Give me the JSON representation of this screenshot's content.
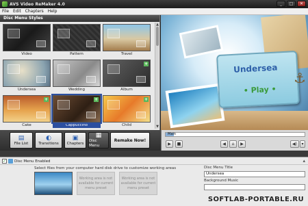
{
  "window": {
    "title": "AVS Video ReMaker 4.0",
    "minimize": "_",
    "maximize": "□",
    "close": "✕"
  },
  "menu": [
    "File",
    "Edit",
    "Chapters",
    "Help"
  ],
  "left_panel": {
    "header": "Disc Menu Styles",
    "styles": [
      {
        "label": "Video",
        "bg": "bg-video"
      },
      {
        "label": "Pattern",
        "bg": "bg-pattern"
      },
      {
        "label": "Travel",
        "bg": "bg-travel"
      },
      {
        "label": "Undersea",
        "bg": "bg-undersea"
      },
      {
        "label": "Wedding",
        "bg": "bg-wedding"
      },
      {
        "label": "Album",
        "bg": "bg-album"
      },
      {
        "label": "Cake",
        "bg": "bg-cake"
      },
      {
        "label": "Cappuccino",
        "bg": "bg-cappuccino"
      },
      {
        "label": "Child",
        "bg": "bg-child"
      }
    ],
    "selected": "Cappuccino"
  },
  "preview": {
    "title": "Undersea",
    "play": "• Play •"
  },
  "toolbar": {
    "buttons": [
      {
        "name": "file-list-button",
        "label": "File List",
        "icon": "▤"
      },
      {
        "name": "transitions-button",
        "label": "Transitions",
        "icon": "◐"
      },
      {
        "name": "chapters-button",
        "label": "Chapters",
        "icon": "▣"
      },
      {
        "name": "disc-menu-button",
        "label": "Disc Menu",
        "icon": "▦"
      }
    ],
    "remake_label": "Remake Now!",
    "remake_icon": "◉"
  },
  "player": {
    "timeline_label": "Main",
    "progress_fraction": 0.06,
    "play": "▶",
    "stop": "■",
    "prev": "◀",
    "home": "⌂",
    "next": "▶",
    "volume": "◀)",
    "volume_arrow": "▾"
  },
  "bottom": {
    "enabled_text": "Disc Menu Enabled",
    "hint": "Select files from your computer hard disk drive to customize working areas",
    "empty_area_text": "Working area is not available for current menu preset",
    "title_label": "Disc Menu Title",
    "title_value": "Undersea",
    "music_label": "Background Music"
  },
  "watermark": "SOFTLAB-PORTABLE.RU"
}
